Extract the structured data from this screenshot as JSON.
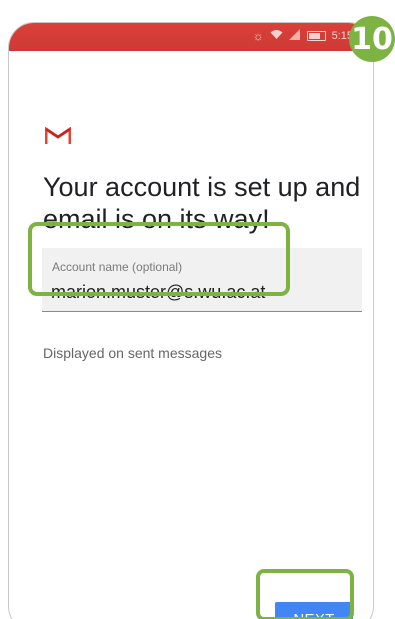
{
  "status_bar": {
    "time": "5:15",
    "icons": [
      "data-saver-icon",
      "wifi-icon",
      "signal-icon",
      "battery-icon"
    ]
  },
  "step_badge": "10",
  "logo": {
    "icon": "gmail-m-icon",
    "colors": [
      "#ea4335",
      "#c5221f"
    ]
  },
  "headline": "Your account is set up and email is on its way!",
  "account_field": {
    "label": "Account name (optional)",
    "value": "marion.muster@s.wu.ac.at"
  },
  "helper_text": "Displayed on sent messages",
  "next_button": {
    "label": "NEXT",
    "color": "#4285f4"
  },
  "colors": {
    "status_bar": "#d9403a",
    "highlight": "#7cb342"
  }
}
